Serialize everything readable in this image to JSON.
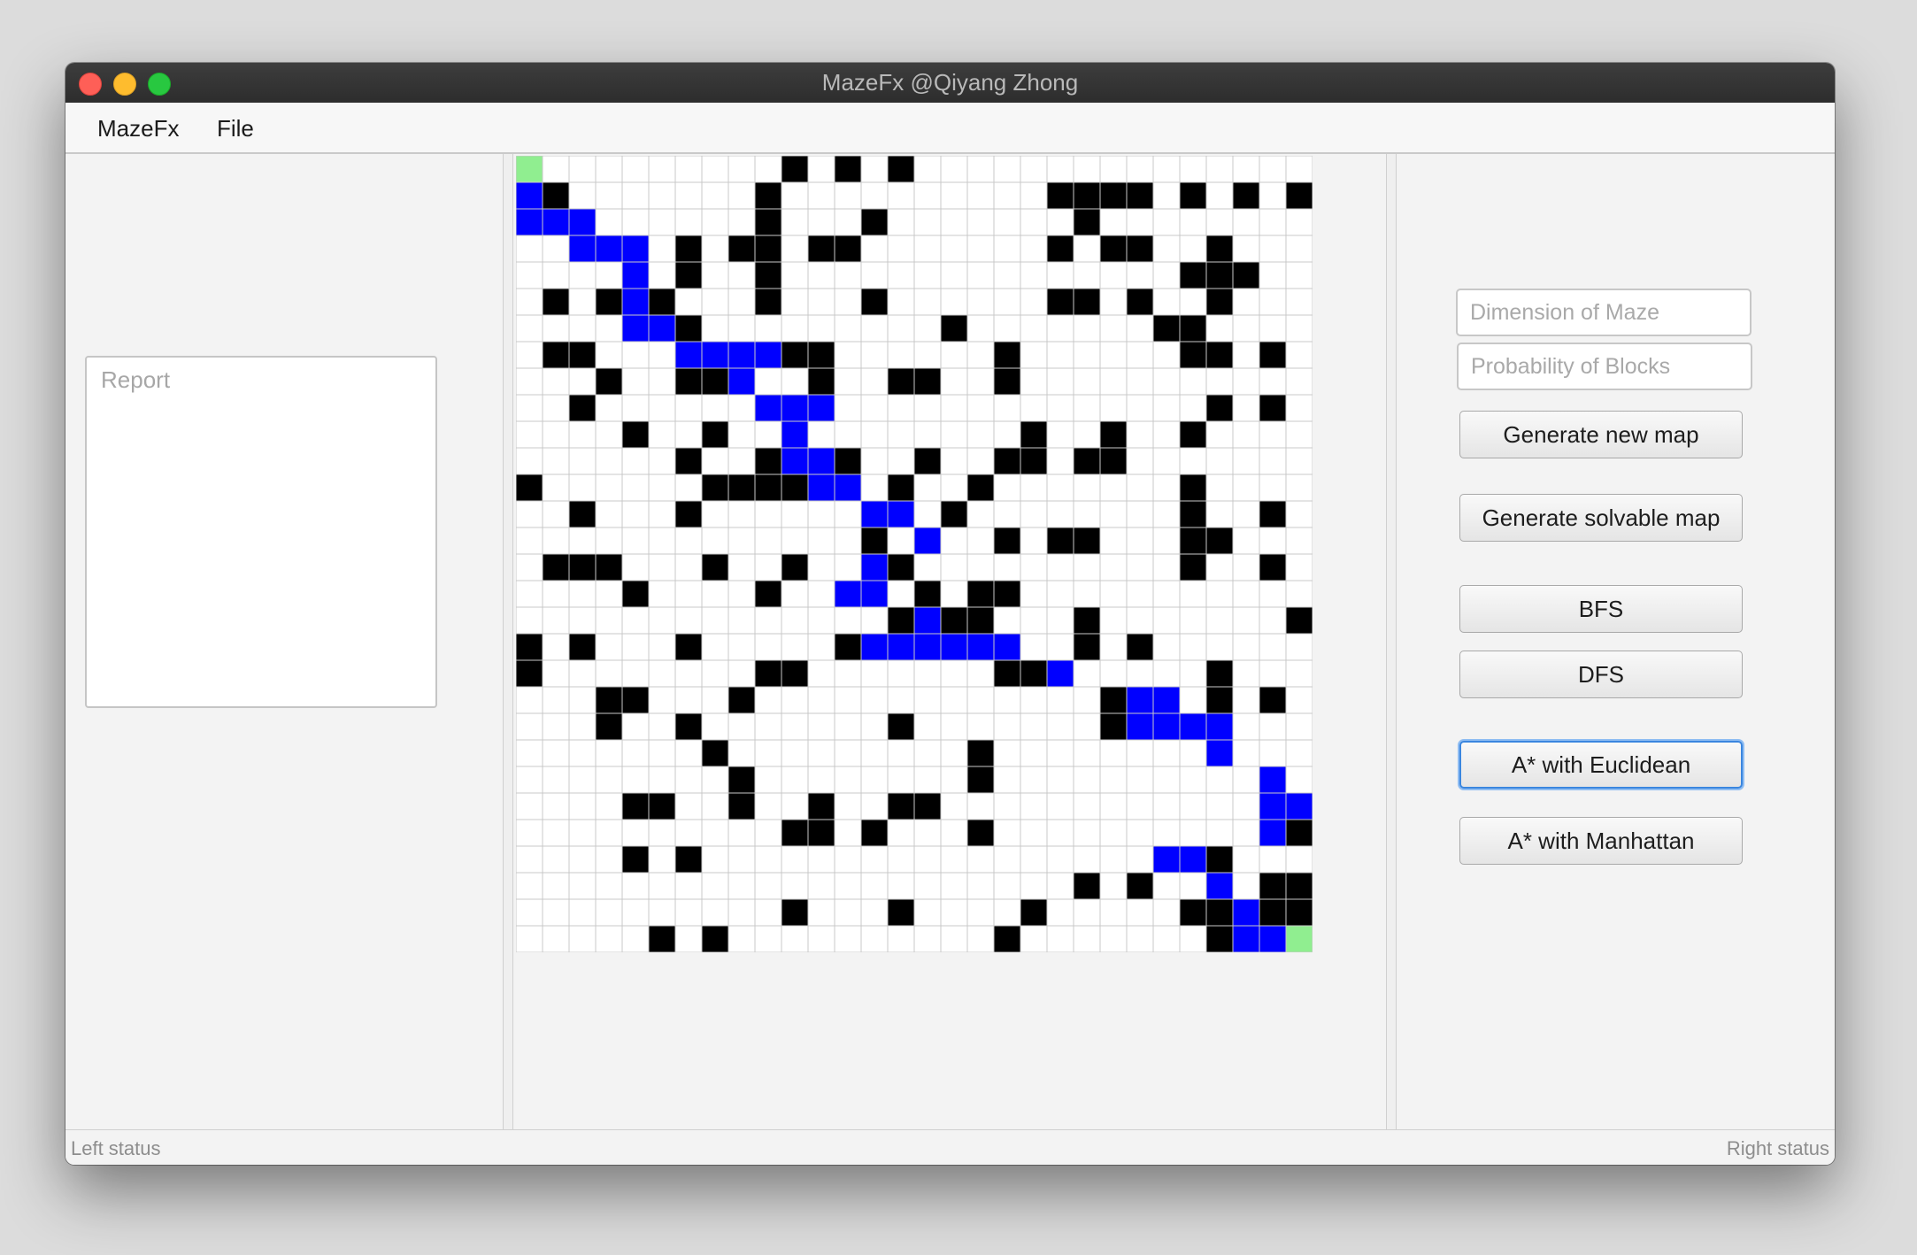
{
  "window": {
    "title": "MazeFx @Qiyang Zhong"
  },
  "menu": {
    "items": [
      "MazeFx",
      "File"
    ]
  },
  "report": {
    "placeholder": "Report"
  },
  "controls": {
    "dimension_placeholder": "Dimension of Maze",
    "probability_placeholder": "Probability of Blocks",
    "buttons": [
      "Generate new map",
      "Generate solvable map",
      "BFS",
      "DFS",
      "A* with Euclidean",
      "A* with Manhattan"
    ],
    "focused_button": "A* with Euclidean"
  },
  "status": {
    "left": "Left status",
    "right": "Right status"
  },
  "maze": {
    "rows": 30,
    "cols": 30,
    "colors": {
      "empty": "#ffffff",
      "wall": "#000000",
      "path": "#0000ff",
      "endpoint": "#90ee90",
      "grid": "#c8c8c8"
    },
    "grid": [
      "S.........#.#.#...............",
      "PW.......#..........####.#.#.##",
      "PPP......#...#.......#........",
      "..PPP.#.##.##.......#.##..#...",
      "....P.#..#...............###..",
      ".#.#PW...#...#......##.#..#...",
      "....PPW.........#.......##....",
      ".##...PPPP##......#......##.#.",
      "...#..##P..#..##..#..........",
      "..#......PPP..............#.#.",
      "....#..#..P........#..#..#....",
      "......#..#PP#..#..##.##.......",
      "#......####PP.#..#.......#...",
      "..#...#......PP.#........#..#.",
      ".............#.P..#.##...##...",
      ".###...#..#..PW..........#..#.",
      "....#....#..PP.#.##...........",
      "..............WP##...#.......#",
      "#.#...#.....WPPPPPP..#.#.....",
      "#........##.......##P.....#...",
      "...##...#.............#PP.#.#.",
      "...#..#.......#.......#PPPP...",
      ".......#.........#........P...#",
      "........#........#..........P..",
      "....##..#..#..##............PPP.#",
      "..........##.#...#..........P##",
      "....#.#.................PP#...",
      ".....................#.#..P.##",
      "..........#...#....#.....##P##",
      ".....#.#..........#.......#PPPE"
    ]
  }
}
